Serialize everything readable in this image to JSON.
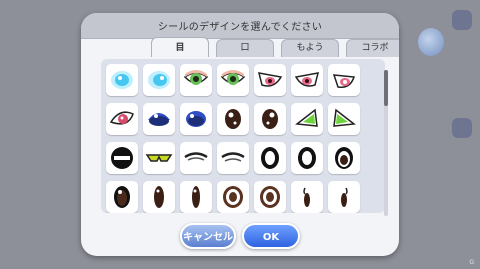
{
  "dialog": {
    "title": "シールのデザインを選んでください",
    "tabs": [
      {
        "label": "目",
        "active": true
      },
      {
        "label": "口",
        "active": false
      },
      {
        "label": "もよう",
        "active": false
      },
      {
        "label": "コラボ",
        "active": false
      }
    ],
    "cancel_label": "キャンセル",
    "ok_label": "OK"
  },
  "stickers": [
    {
      "name": "eye-glow-cyan-icon",
      "color": "#46c7f0"
    },
    {
      "name": "eye-glow-cyan-2-icon",
      "color": "#46c7f0"
    },
    {
      "name": "eye-green-left-icon",
      "color": "#6bbf5a"
    },
    {
      "name": "eye-green-right-icon",
      "color": "#6bbf5a"
    },
    {
      "name": "eye-pink-slant-icon",
      "color": "#e86a8a"
    },
    {
      "name": "eye-pink-slant-2-icon",
      "color": "#e86a8a"
    },
    {
      "name": "eye-pink-star-icon",
      "color": "#e86a8a"
    },
    {
      "name": "eye-red-almond-icon",
      "color": "#d64a6a"
    },
    {
      "name": "eye-blue-cap-icon",
      "color": "#2e4fc4"
    },
    {
      "name": "eye-blue-round-icon",
      "color": "#2e4fc4"
    },
    {
      "name": "eye-brown-round-icon",
      "color": "#3a1f14"
    },
    {
      "name": "eye-brown-round-2-icon",
      "color": "#3a1f14"
    },
    {
      "name": "eye-green-slant-icon",
      "color": "#6cd43a"
    },
    {
      "name": "eye-green-slant-2-icon",
      "color": "#6cd43a"
    },
    {
      "name": "eye-closed-bar-icon",
      "color": "#111111"
    },
    {
      "name": "eye-glasses-icon",
      "color": "#c8d820"
    },
    {
      "name": "eye-lashes-icon",
      "color": "#222222"
    },
    {
      "name": "eye-lashes-2-icon",
      "color": "#222222"
    },
    {
      "name": "eye-ring-black-icon",
      "color": "#111111"
    },
    {
      "name": "eye-ring-black-2-icon",
      "color": "#111111"
    },
    {
      "name": "eye-ring-brown-icon",
      "color": "#3a1f14"
    },
    {
      "name": "eye-oval-brown-icon",
      "color": "#4a2a1a"
    },
    {
      "name": "eye-tall-brown-icon",
      "color": "#3a1f14"
    },
    {
      "name": "eye-tall-brown-2-icon",
      "color": "#3a1f14"
    },
    {
      "name": "eye-ring-swirl-icon",
      "color": "#5a3220"
    },
    {
      "name": "eye-ring-swirl-2-icon",
      "color": "#5a3220"
    },
    {
      "name": "eye-sliver-icon",
      "color": "#3a1f14"
    },
    {
      "name": "eye-sliver-2-icon",
      "color": "#3a1f14"
    }
  ],
  "watermark": "G"
}
